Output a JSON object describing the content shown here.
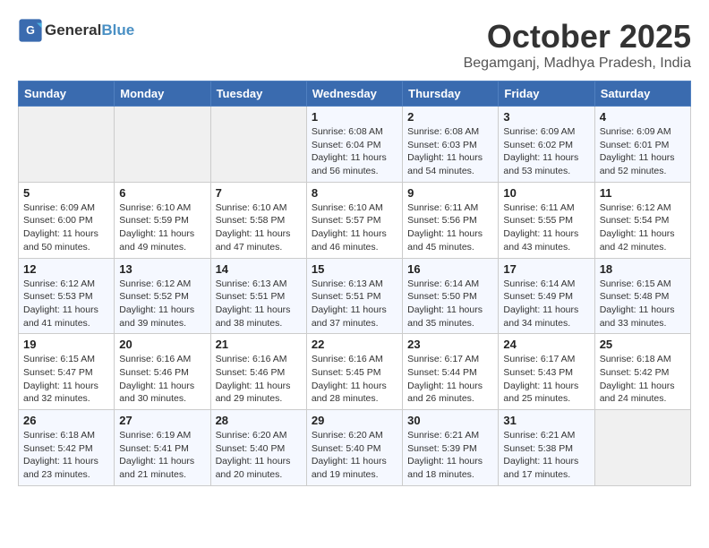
{
  "header": {
    "logo_general": "General",
    "logo_blue": "Blue",
    "month": "October 2025",
    "location": "Begamganj, Madhya Pradesh, India"
  },
  "weekdays": [
    "Sunday",
    "Monday",
    "Tuesday",
    "Wednesday",
    "Thursday",
    "Friday",
    "Saturday"
  ],
  "weeks": [
    [
      {
        "day": "",
        "info": ""
      },
      {
        "day": "",
        "info": ""
      },
      {
        "day": "",
        "info": ""
      },
      {
        "day": "1",
        "info": "Sunrise: 6:08 AM\nSunset: 6:04 PM\nDaylight: 11 hours and 56 minutes."
      },
      {
        "day": "2",
        "info": "Sunrise: 6:08 AM\nSunset: 6:03 PM\nDaylight: 11 hours and 54 minutes."
      },
      {
        "day": "3",
        "info": "Sunrise: 6:09 AM\nSunset: 6:02 PM\nDaylight: 11 hours and 53 minutes."
      },
      {
        "day": "4",
        "info": "Sunrise: 6:09 AM\nSunset: 6:01 PM\nDaylight: 11 hours and 52 minutes."
      }
    ],
    [
      {
        "day": "5",
        "info": "Sunrise: 6:09 AM\nSunset: 6:00 PM\nDaylight: 11 hours and 50 minutes."
      },
      {
        "day": "6",
        "info": "Sunrise: 6:10 AM\nSunset: 5:59 PM\nDaylight: 11 hours and 49 minutes."
      },
      {
        "day": "7",
        "info": "Sunrise: 6:10 AM\nSunset: 5:58 PM\nDaylight: 11 hours and 47 minutes."
      },
      {
        "day": "8",
        "info": "Sunrise: 6:10 AM\nSunset: 5:57 PM\nDaylight: 11 hours and 46 minutes."
      },
      {
        "day": "9",
        "info": "Sunrise: 6:11 AM\nSunset: 5:56 PM\nDaylight: 11 hours and 45 minutes."
      },
      {
        "day": "10",
        "info": "Sunrise: 6:11 AM\nSunset: 5:55 PM\nDaylight: 11 hours and 43 minutes."
      },
      {
        "day": "11",
        "info": "Sunrise: 6:12 AM\nSunset: 5:54 PM\nDaylight: 11 hours and 42 minutes."
      }
    ],
    [
      {
        "day": "12",
        "info": "Sunrise: 6:12 AM\nSunset: 5:53 PM\nDaylight: 11 hours and 41 minutes."
      },
      {
        "day": "13",
        "info": "Sunrise: 6:12 AM\nSunset: 5:52 PM\nDaylight: 11 hours and 39 minutes."
      },
      {
        "day": "14",
        "info": "Sunrise: 6:13 AM\nSunset: 5:51 PM\nDaylight: 11 hours and 38 minutes."
      },
      {
        "day": "15",
        "info": "Sunrise: 6:13 AM\nSunset: 5:51 PM\nDaylight: 11 hours and 37 minutes."
      },
      {
        "day": "16",
        "info": "Sunrise: 6:14 AM\nSunset: 5:50 PM\nDaylight: 11 hours and 35 minutes."
      },
      {
        "day": "17",
        "info": "Sunrise: 6:14 AM\nSunset: 5:49 PM\nDaylight: 11 hours and 34 minutes."
      },
      {
        "day": "18",
        "info": "Sunrise: 6:15 AM\nSunset: 5:48 PM\nDaylight: 11 hours and 33 minutes."
      }
    ],
    [
      {
        "day": "19",
        "info": "Sunrise: 6:15 AM\nSunset: 5:47 PM\nDaylight: 11 hours and 32 minutes."
      },
      {
        "day": "20",
        "info": "Sunrise: 6:16 AM\nSunset: 5:46 PM\nDaylight: 11 hours and 30 minutes."
      },
      {
        "day": "21",
        "info": "Sunrise: 6:16 AM\nSunset: 5:46 PM\nDaylight: 11 hours and 29 minutes."
      },
      {
        "day": "22",
        "info": "Sunrise: 6:16 AM\nSunset: 5:45 PM\nDaylight: 11 hours and 28 minutes."
      },
      {
        "day": "23",
        "info": "Sunrise: 6:17 AM\nSunset: 5:44 PM\nDaylight: 11 hours and 26 minutes."
      },
      {
        "day": "24",
        "info": "Sunrise: 6:17 AM\nSunset: 5:43 PM\nDaylight: 11 hours and 25 minutes."
      },
      {
        "day": "25",
        "info": "Sunrise: 6:18 AM\nSunset: 5:42 PM\nDaylight: 11 hours and 24 minutes."
      }
    ],
    [
      {
        "day": "26",
        "info": "Sunrise: 6:18 AM\nSunset: 5:42 PM\nDaylight: 11 hours and 23 minutes."
      },
      {
        "day": "27",
        "info": "Sunrise: 6:19 AM\nSunset: 5:41 PM\nDaylight: 11 hours and 21 minutes."
      },
      {
        "day": "28",
        "info": "Sunrise: 6:20 AM\nSunset: 5:40 PM\nDaylight: 11 hours and 20 minutes."
      },
      {
        "day": "29",
        "info": "Sunrise: 6:20 AM\nSunset: 5:40 PM\nDaylight: 11 hours and 19 minutes."
      },
      {
        "day": "30",
        "info": "Sunrise: 6:21 AM\nSunset: 5:39 PM\nDaylight: 11 hours and 18 minutes."
      },
      {
        "day": "31",
        "info": "Sunrise: 6:21 AM\nSunset: 5:38 PM\nDaylight: 11 hours and 17 minutes."
      },
      {
        "day": "",
        "info": ""
      }
    ]
  ]
}
